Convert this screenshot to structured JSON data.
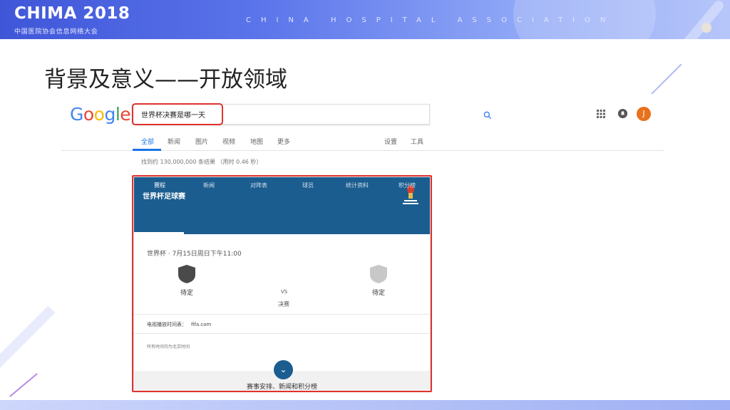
{
  "slide": {
    "logo_main": "CHIMA 2018",
    "logo_sub": "中国医院协会信息网络大会",
    "association": "CHINA HOSPITAL ASSOCIATION",
    "title": "背景及意义——开放领域"
  },
  "google": {
    "logo": "Google",
    "search_value": "世界杯决赛是哪一天",
    "avatar_letter": "J",
    "tabs": [
      "全部",
      "新闻",
      "图片",
      "视频",
      "地图",
      "更多"
    ],
    "tools": [
      "设置",
      "工具"
    ],
    "result_count": "找到约 130,000,000 条结果 （用时 0.46 秒）"
  },
  "card": {
    "title": "世界杯足球赛",
    "logo_text": "FIFA WORLD CUP RUSSIA 2018",
    "tabs": [
      "赛程",
      "新闻",
      "对阵表",
      "球员",
      "统计资料",
      "积分榜"
    ],
    "match_date": "世界杯 · 7月15日周日下午11:00",
    "team1": "待定",
    "team2": "待定",
    "vs": "VS",
    "stage": "决赛",
    "tv_label": "电视播放时间表：",
    "tv_link": "fifa.com",
    "tz_note": "所有时间均为北京时间",
    "footer": "赛事安排、新闻和积分榜"
  },
  "colors": {
    "accent": "#1a73e8",
    "card_header": "#1b5d8f",
    "highlight": "#e0322e",
    "avatar": "#e8711e"
  }
}
